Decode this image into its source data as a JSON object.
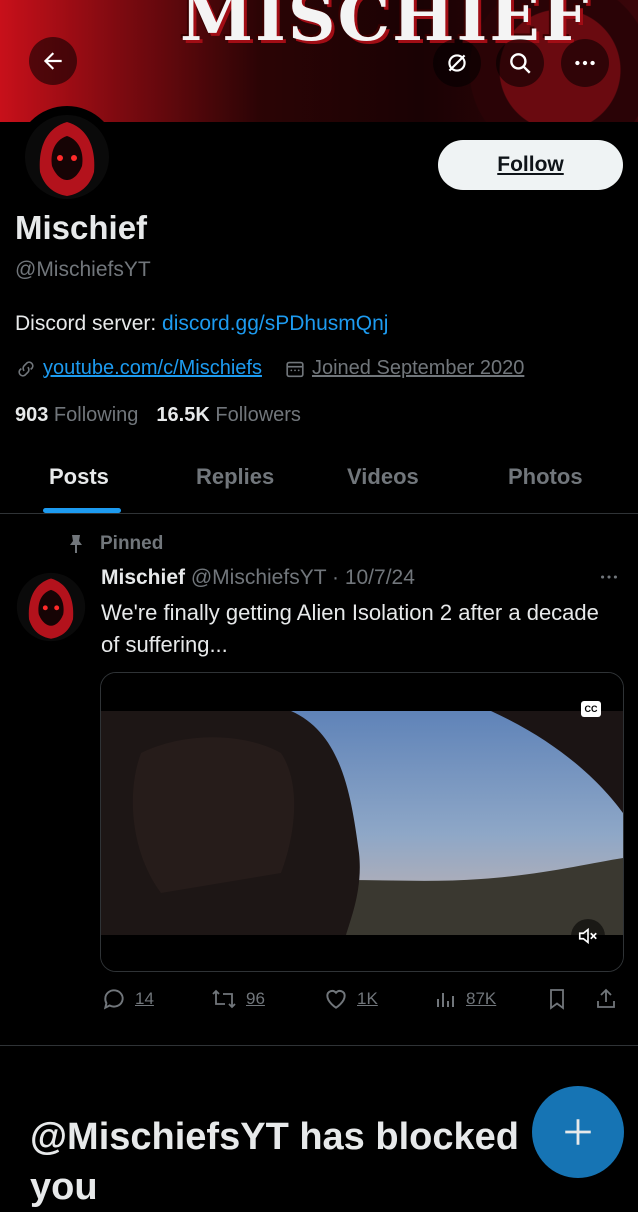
{
  "banner": {
    "text": "MISCHIEF"
  },
  "profile": {
    "follow_label": "Follow",
    "display_name": "Mischief",
    "handle": "@MischiefsYT",
    "bio_prefix": "Discord server: ",
    "bio_link": "discord.gg/sPDhusmQnj",
    "website": "youtube.com/c/Mischiefs",
    "joined": "Joined September 2020",
    "following_count": "903",
    "following_label": " Following",
    "followers_count": "16.5K",
    "followers_label": " Followers"
  },
  "tabs": [
    {
      "label": "Posts",
      "active": true
    },
    {
      "label": "Replies"
    },
    {
      "label": "Videos"
    },
    {
      "label": "Photos"
    }
  ],
  "post": {
    "pinned_label": "Pinned",
    "author": "Mischief",
    "handle_date": " @MischiefsYT · 10/7/24",
    "text": "We're finally getting Alien Isolation 2 after a decade of suffering...",
    "cc_label": "CC",
    "reply_count": "14",
    "repost_count": "96",
    "like_count": "1K",
    "view_count": "87K"
  },
  "blocked_message": "@MischiefsYT has blocked you",
  "colors": {
    "accent": "#1d9bf0",
    "muted": "#71767b",
    "background": "#000000"
  }
}
